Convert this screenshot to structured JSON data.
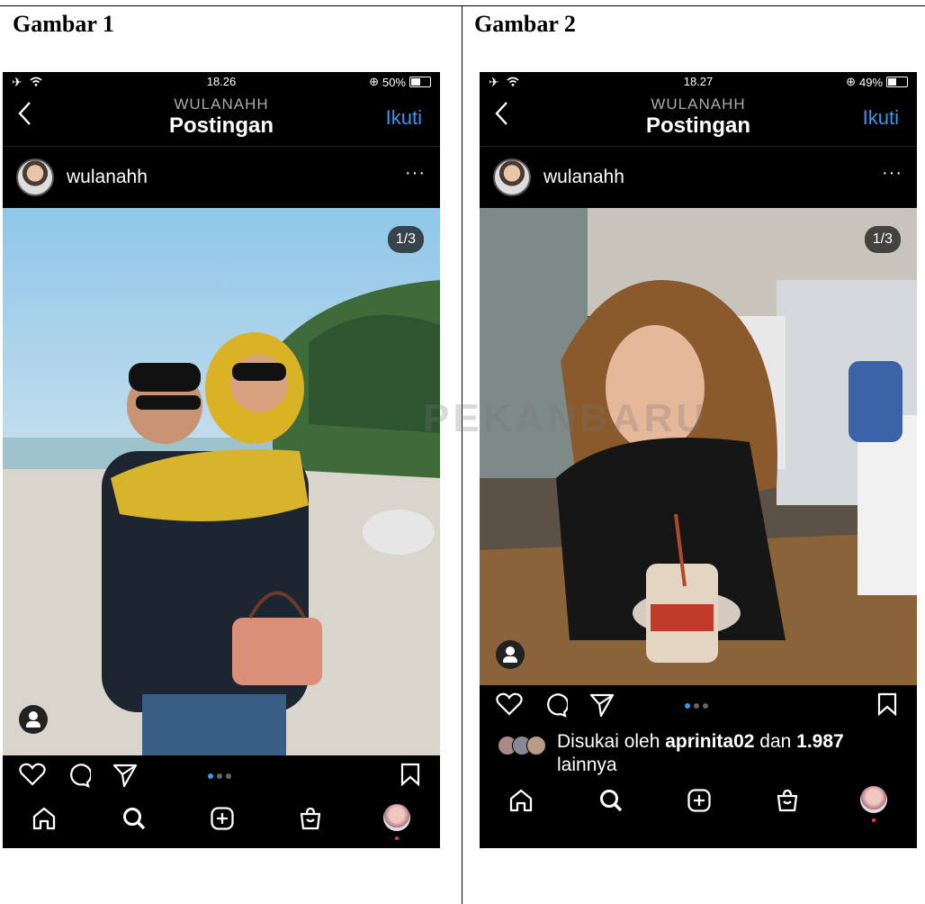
{
  "captions": {
    "left": "Gambar 1",
    "right": "Gambar 2"
  },
  "watermark": "PEKANBARU",
  "accent_color": "#3897f0",
  "left_phone": {
    "status": {
      "time": "18.26",
      "battery": "50%",
      "icons": [
        "airplane-icon",
        "wifi-icon",
        "orientation-lock-icon"
      ]
    },
    "header": {
      "username": "WULANAHH",
      "title": "Postingan",
      "follow": "Ikuti",
      "back_icon": "chevron-left-icon"
    },
    "post_user": "wulanahh",
    "more": "···",
    "counter": "1/3",
    "carousel": {
      "count": 3,
      "active": 1
    }
  },
  "right_phone": {
    "status": {
      "time": "18.27",
      "battery": "49%",
      "icons": [
        "airplane-icon",
        "wifi-icon",
        "orientation-lock-icon"
      ]
    },
    "header": {
      "username": "WULANAHH",
      "title": "Postingan",
      "follow": "Ikuti",
      "back_icon": "chevron-left-icon"
    },
    "post_user": "wulanahh",
    "more": "···",
    "counter": "1/3",
    "carousel": {
      "count": 3,
      "active": 1
    },
    "likes": {
      "prefix": "Disukai oleh ",
      "user": "aprinita02",
      "middle": " dan ",
      "count": "1.987",
      "suffix": "lainnya"
    }
  },
  "nav_icons": [
    "home-icon",
    "search-icon",
    "new-post-icon",
    "shop-icon",
    "profile-icon"
  ]
}
